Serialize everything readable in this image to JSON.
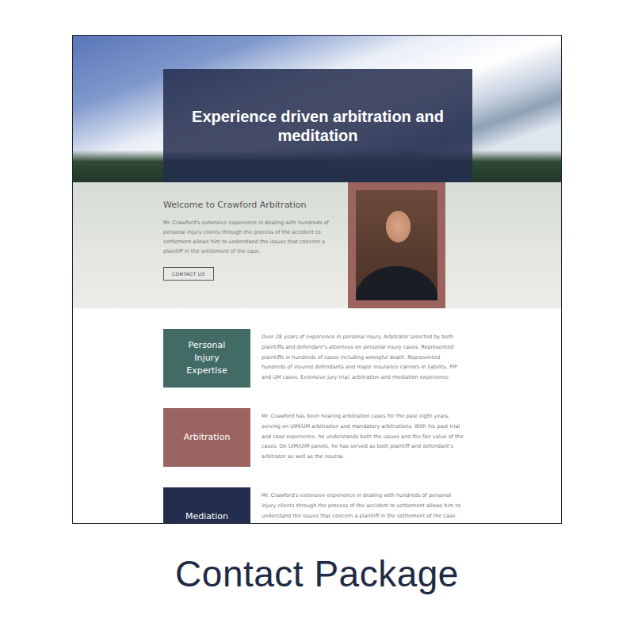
{
  "hero": {
    "title": "Experience driven arbitration and meditation"
  },
  "welcome": {
    "heading": "Welcome to Crawford Arbitration",
    "body": "Mr. Crawford's extensive experience in dealing with hundreds of personal injury clients through the process of the accident to settlement allows him to understand the issues that concern a plaintiff in the settlement of the case.",
    "button": "CONTACT US"
  },
  "services": [
    {
      "label": "Personal Injury Expertise",
      "color": "#436b66",
      "description": "Over 28 years of experience in personal injury. Arbitrator selected by both plaintiffs and defendant's attorneys on personal injury cases. Represented plaintiffs in hundreds of cases including wrongful death. Represented hundreds of insured defendants and major insurance carriers in liability, PIP and UM cases. Extensive jury trial, arbitration and mediation experience."
    },
    {
      "label": "Arbitration",
      "color": "#9b6461",
      "description": "Mr. Crawford has been hearing arbitration cases for the past eight years, serving on UIM/UM arbitration and mandatory arbitrations. With his past trial and case experience, he understands both the issues and the fair value of the cases. On UIM/UIM panels, he has served as both plaintiff and defendant's arbitrator as well as the neutral."
    },
    {
      "label": "Mediation",
      "color": "#232d4e",
      "description": "Mr. Crawford's extensive experience in dealing with hundreds of personal injury clients through the process of the accident to settlement allows him to understand the issues that concern a plaintiff in the settlement of the case."
    }
  ],
  "caption": "Contact Package"
}
